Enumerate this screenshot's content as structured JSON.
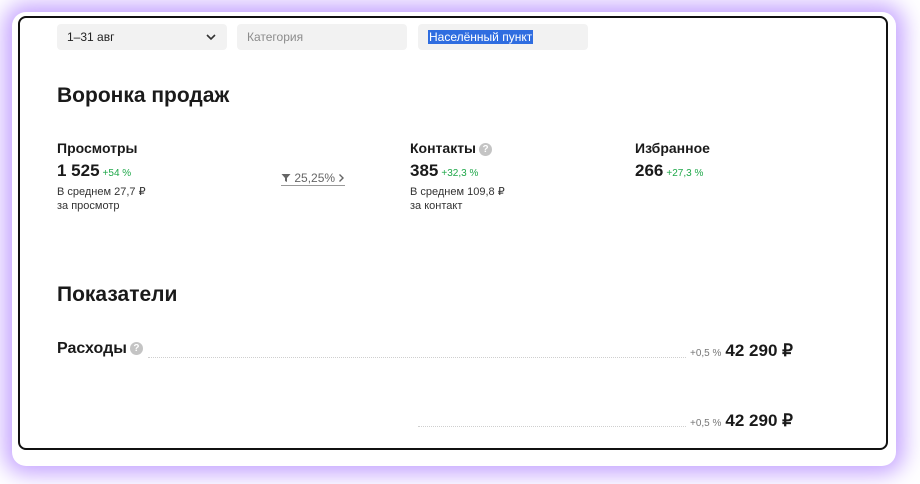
{
  "filters": {
    "date_range": "1–31 авг",
    "category_placeholder": "Категория",
    "location_text": "Населённый пункт"
  },
  "funnel": {
    "title": "Воронка продаж",
    "views": {
      "label": "Просмотры",
      "value": "1 525",
      "delta": "+54 %",
      "avg_line1": "В среднем 27,7 ₽",
      "avg_line2": "за просмотр"
    },
    "conversion": "25,25%",
    "contacts": {
      "label": "Контакты",
      "value": "385",
      "delta": "+32,3 %",
      "avg_line1": "В среднем 109,8 ₽",
      "avg_line2": "за контакт"
    },
    "favorites": {
      "label": "Избранное",
      "value": "266",
      "delta": "+27,3 %"
    }
  },
  "metrics": {
    "title": "Показатели",
    "expenses": {
      "label": "Расходы",
      "change": "+0,5 %",
      "value": "42 290 ₽"
    },
    "row2": {
      "change": "+0,5 %",
      "value": "42 290 ₽"
    }
  },
  "colors": {
    "positive": "#20a84a",
    "selection": "#2f6de0",
    "glow": "#965aff"
  }
}
